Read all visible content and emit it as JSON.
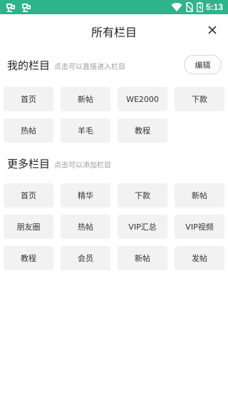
{
  "status_bar": {
    "time": "5:13",
    "colors": {
      "background": "#2fb38a"
    },
    "icons": [
      "app-notification-icon",
      "app-notification-icon",
      "wifi-icon",
      "no-sim-icon",
      "battery-charging-icon"
    ]
  },
  "header": {
    "title": "所有栏目",
    "close_icon": "close-icon"
  },
  "my_channels": {
    "title": "我的栏目",
    "hint": "点击可以直接进入栏目",
    "edit_label": "编辑",
    "items": [
      "首页",
      "新帖",
      "WE2000",
      "下款",
      "热帖",
      "羊毛",
      "教程"
    ]
  },
  "more_channels": {
    "title": "更多栏目",
    "hint": "点击可以添加栏目",
    "items": [
      "首页",
      "精华",
      "下款",
      "新帖",
      "朋友圈",
      "热帖",
      "VIP汇总",
      "VIP视频",
      "教程",
      "会员",
      "新帖",
      "发帖"
    ]
  }
}
